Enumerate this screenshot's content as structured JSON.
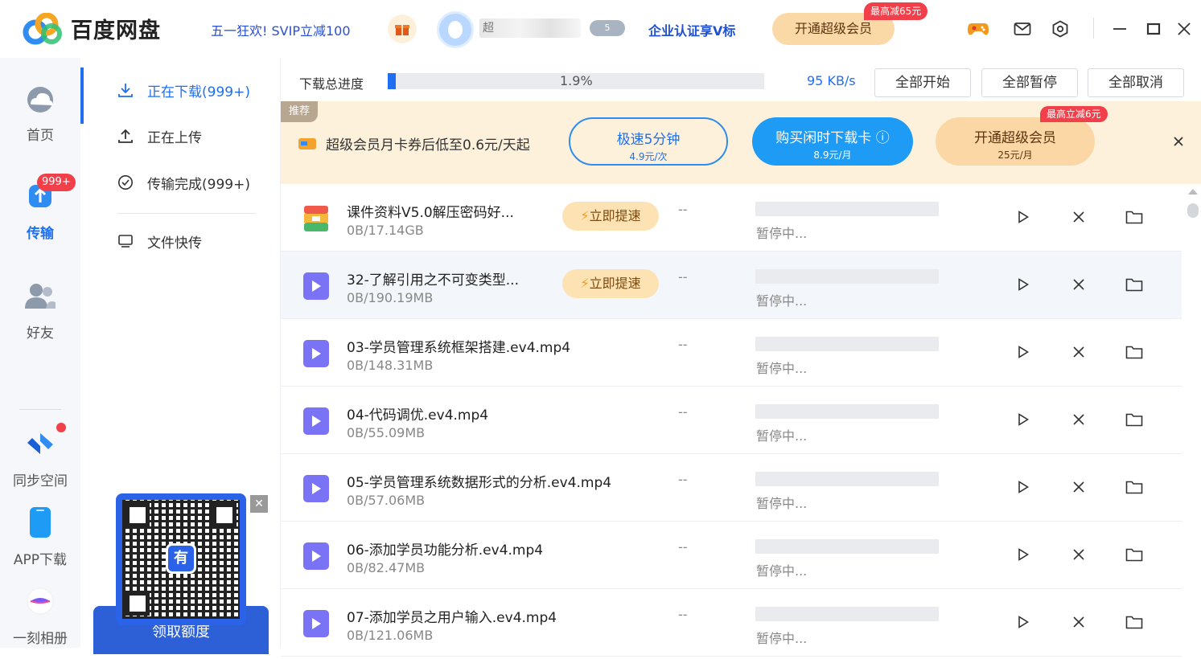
{
  "app": {
    "brand": "百度网盘",
    "promo": "五一狂欢! SVIP立减100",
    "username": "超",
    "level": "5",
    "enterprise": "企业认证享V标",
    "vip_button": "开通超级会员",
    "vip_tag": "最高减65元",
    "icons": [
      "gift-icon",
      "game-icon",
      "mail-icon",
      "settings-icon",
      "minimize-icon",
      "maximize-icon",
      "close-icon"
    ]
  },
  "leftnav": {
    "items": [
      {
        "label": "首页",
        "icon": "cloud-icon"
      },
      {
        "label": "传输",
        "icon": "transfer-icon",
        "badge": "999+"
      },
      {
        "label": "好友",
        "icon": "friends-icon"
      },
      {
        "label": "同步空间",
        "icon": "sync-icon"
      },
      {
        "label": "APP下载",
        "icon": "phone-icon"
      },
      {
        "label": "一刻相册",
        "icon": "album-icon"
      }
    ]
  },
  "subnav": {
    "items": [
      {
        "label": "正在下载(999+)",
        "icon": "download-icon"
      },
      {
        "label": "正在上传",
        "icon": "upload-icon"
      },
      {
        "label": "传输完成(999+)",
        "icon": "check-circle-icon"
      },
      {
        "label": "文件快传",
        "icon": "monitor-icon"
      }
    ],
    "qr_logo": "有",
    "qr_button": "领取额度"
  },
  "progress": {
    "label": "下载总进度",
    "percent_text": "1.9%",
    "percent": 1.9,
    "speed": "95 KB/s",
    "buttons": [
      "全部开始",
      "全部暂停",
      "全部取消"
    ]
  },
  "banner": {
    "tag": "推荐",
    "text": "超级会员月卡券后低至0.6元/天起",
    "btn1_title": "极速5分钟",
    "btn1_sub": "4.9元/次",
    "btn2_title": "购买闲时下载卡",
    "btn2_sub": "8.9元/月",
    "btn3_title": "开通超级会员",
    "btn3_sub": "25元/月",
    "btn3_tag": "最高立减6元"
  },
  "downloads": [
    {
      "name": "课件资料V5.0解压密码好...",
      "size": "0B/17.14GB",
      "speedup": "立即提速",
      "speed": "--",
      "status": "暂停中...",
      "type": "zip"
    },
    {
      "name": "32-了解引用之不可变类型...",
      "size": "0B/190.19MB",
      "speedup": "立即提速",
      "speed": "--",
      "status": "暂停中...",
      "type": "video"
    },
    {
      "name": "03-学员管理系统框架搭建.ev4.mp4",
      "size": "0B/148.31MB",
      "speed": "--",
      "status": "暂停中...",
      "type": "video"
    },
    {
      "name": "04-代码调优.ev4.mp4",
      "size": "0B/55.09MB",
      "speed": "--",
      "status": "暂停中...",
      "type": "video"
    },
    {
      "name": "05-学员管理系统数据形式的分析.ev4.mp4",
      "size": "0B/57.06MB",
      "speed": "--",
      "status": "暂停中...",
      "type": "video"
    },
    {
      "name": "06-添加学员功能分析.ev4.mp4",
      "size": "0B/82.47MB",
      "speed": "--",
      "status": "暂停中...",
      "type": "video"
    },
    {
      "name": "07-添加学员之用户输入.ev4.mp4",
      "size": "0B/121.06MB",
      "speed": "--",
      "status": "暂停中...",
      "type": "video"
    }
  ],
  "colors": {
    "accent": "#1f6ff0",
    "vip": "#fbd9a6",
    "banner_bg": "#fdf1dc",
    "badge": "#f2404b"
  }
}
